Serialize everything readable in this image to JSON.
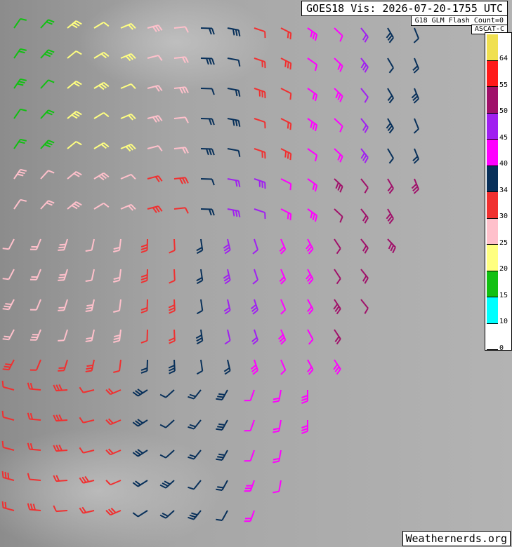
{
  "header": {
    "title": "GOES18 Vis: 2026-07-20-1755 UTC",
    "flash_count": "G18 GLM Flash Count=0",
    "satellite": "ASCAT-C"
  },
  "credit": "Weathernerds.org",
  "legend": {
    "ticks": [
      "64",
      "55",
      "50",
      "45",
      "40",
      "34",
      "30",
      "25",
      "20",
      "15",
      "10",
      "0"
    ],
    "bins": [
      {
        "color": "#f0e050"
      },
      {
        "color": "#ff1a1a"
      },
      {
        "color": "#a0106a"
      },
      {
        "color": "#a020f0"
      },
      {
        "color": "#ff00ff"
      },
      {
        "color": "#08305a"
      },
      {
        "color": "#f03030"
      },
      {
        "color": "#ffc0cb"
      },
      {
        "color": "#ffff80"
      },
      {
        "color": "#12c012"
      },
      {
        "color": "#00ffff"
      },
      {
        "color": "#ffffff"
      }
    ]
  },
  "wind_speed_colors": {
    "green": "#12c012",
    "yellow": "#ffff80",
    "pink": "#ffc0cb",
    "red": "#f03030",
    "navy": "#08305a",
    "magenta": "#ff00ff",
    "purple": "#a020f0",
    "maroon": "#a0106a"
  }
}
